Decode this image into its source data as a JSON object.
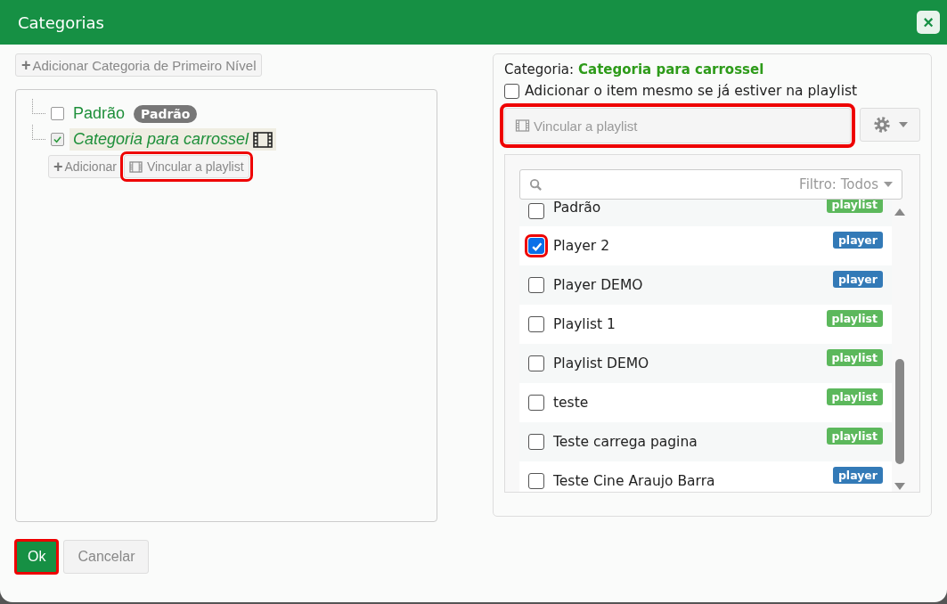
{
  "window": {
    "title": "Categorias",
    "close": "×"
  },
  "add_top_button": {
    "icon": "+",
    "label": "Adicionar Categoria de Primeiro Nível"
  },
  "tree": [
    {
      "label": "Padrão",
      "checked": false,
      "selected": false,
      "badge": "Padrão",
      "film": false
    },
    {
      "label": "Categoria para carrossel",
      "checked": true,
      "selected": true,
      "film": true
    }
  ],
  "node_actions": [
    {
      "icon": "+",
      "label": "Adicionar",
      "highlighted": false
    },
    {
      "label": "Vincular a playlist",
      "highlighted": true
    }
  ],
  "detail": {
    "category_label": "Categoria:",
    "category_name": "Categoria para carrossel",
    "add_even_if_present": {
      "label": "Adicionar o item mesmo se já estiver na playlist",
      "checked": false
    },
    "link_field": {
      "placeholder": "Vincular a playlist",
      "highlighted": true
    },
    "filter": {
      "label": "Filtro: Todos"
    },
    "items": [
      {
        "name": "Padrão",
        "checked": false,
        "highlighted": false,
        "tag": "playlist",
        "kind": "playlist"
      },
      {
        "name": "Player 2",
        "checked": true,
        "highlighted": true,
        "tag": "player",
        "kind": "player"
      },
      {
        "name": "Player DEMO",
        "checked": false,
        "highlighted": false,
        "tag": "player",
        "kind": "player"
      },
      {
        "name": "Playlist 1",
        "checked": false,
        "highlighted": false,
        "tag": "playlist",
        "kind": "playlist"
      },
      {
        "name": "Playlist DEMO",
        "checked": false,
        "highlighted": false,
        "tag": "playlist",
        "kind": "playlist"
      },
      {
        "name": "teste",
        "checked": false,
        "highlighted": false,
        "tag": "playlist",
        "kind": "playlist"
      },
      {
        "name": "Teste carrega pagina",
        "checked": false,
        "highlighted": false,
        "tag": "playlist",
        "kind": "playlist"
      },
      {
        "name": "Teste Cine Araujo Barra",
        "checked": false,
        "highlighted": false,
        "tag": "player",
        "kind": "player"
      }
    ]
  },
  "footer": [
    {
      "label": "Ok",
      "kind": "primary",
      "highlighted": true
    },
    {
      "label": "Cancelar",
      "kind": "default",
      "highlighted": false
    }
  ]
}
